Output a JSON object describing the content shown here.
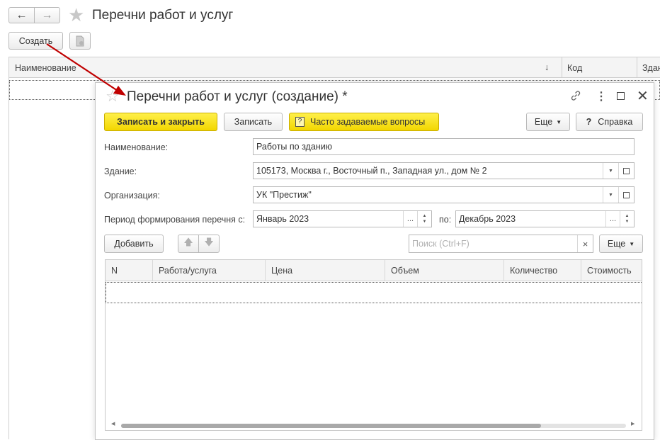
{
  "back_window": {
    "title": "Перечни работ и услуг",
    "create_button": "Создать",
    "columns": [
      "Наименование",
      "↓",
      "Код",
      "Здан"
    ]
  },
  "dialog": {
    "title": "Перечни работ и услуг (создание) *",
    "toolbar": {
      "save_close": "Записать и закрыть",
      "save": "Записать",
      "faq_icon": "?",
      "faq": "Часто задаваемые вопросы",
      "more": "Еще",
      "help_icon": "?",
      "help": "Справка"
    },
    "fields": {
      "name_label": "Наименование:",
      "name_value": "Работы по зданию",
      "building_label": "Здание:",
      "building_value": "105173, Москва г., Восточный п., Западная ул., дом № 2",
      "org_label": "Организация:",
      "org_value": "УК \"Престиж\"",
      "period_label": "Период формирования перечня с:",
      "period_from": "Январь 2023",
      "period_to_label": "по:",
      "period_to": "Декабрь 2023"
    },
    "table_toolbar": {
      "add": "Добавить",
      "search_placeholder": "Поиск (Ctrl+F)",
      "clear": "×",
      "more": "Еще"
    },
    "table": {
      "columns": [
        "N",
        "Работа/услуга",
        "Цена",
        "Объем",
        "Количество",
        "Стоимость"
      ]
    }
  }
}
